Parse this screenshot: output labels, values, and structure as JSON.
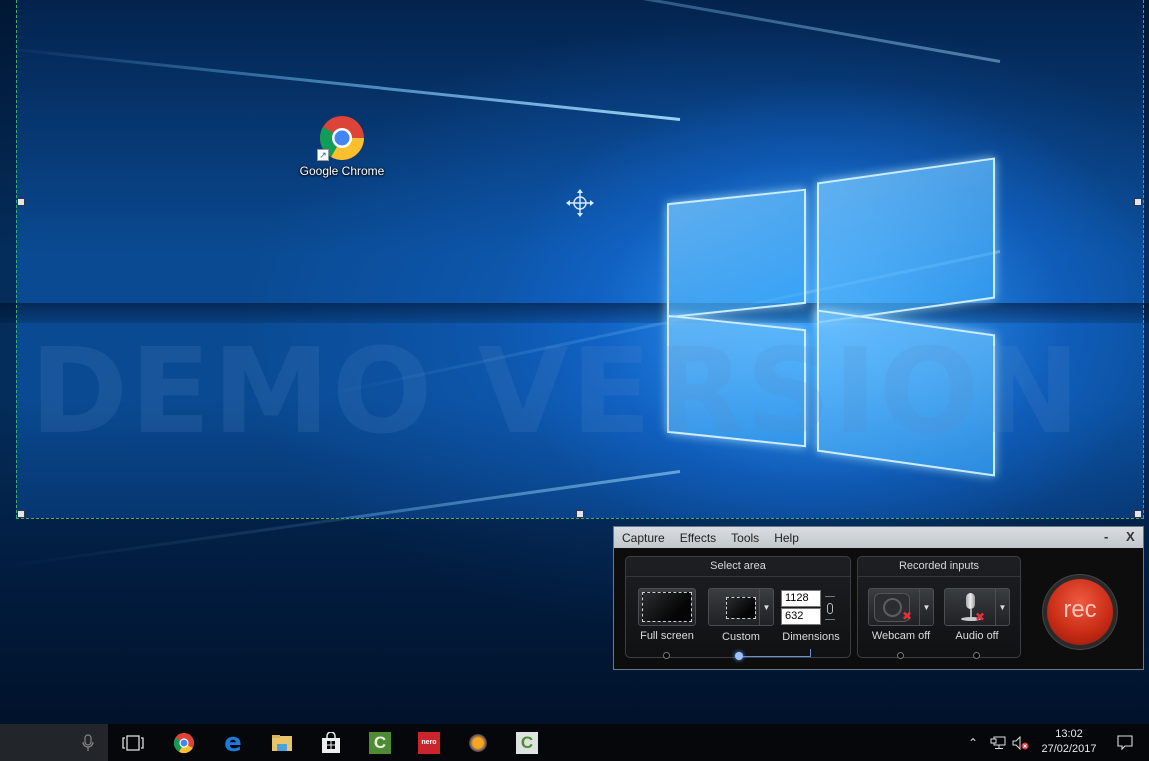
{
  "desktop": {
    "watermark": "DEMO VERSION",
    "shortcuts": [
      {
        "label": "Google Chrome",
        "icon": "chrome-icon"
      }
    ],
    "capture_overlay": {
      "selection_color": "#3fae6a",
      "center_icon": "move-crosshair-icon"
    }
  },
  "recorder": {
    "menu": [
      "Capture",
      "Effects",
      "Tools",
      "Help"
    ],
    "window_buttons": {
      "minimize": "-",
      "close": "X"
    },
    "select_area": {
      "title": "Select area",
      "full_screen_label": "Full screen",
      "custom_label": "Custom",
      "dimensions_label": "Dimensions",
      "width": "1128",
      "height": "632",
      "selected": "Custom"
    },
    "recorded_inputs": {
      "title": "Recorded inputs",
      "webcam_label": "Webcam off",
      "audio_label": "Audio off"
    },
    "rec_label": "rec",
    "rec_color": "#d9351c"
  },
  "taskbar": {
    "pinned": [
      {
        "name": "task-view",
        "icon": "task-view-icon"
      },
      {
        "name": "chrome",
        "icon": "chrome-icon"
      },
      {
        "name": "edge",
        "icon": "edge-icon"
      },
      {
        "name": "file-explorer",
        "icon": "folder-icon"
      },
      {
        "name": "store",
        "icon": "store-icon"
      },
      {
        "name": "camtasia-green",
        "icon": "camtasia-icon"
      },
      {
        "name": "nero",
        "icon": "nero-icon",
        "label": "nero"
      },
      {
        "name": "app-orange",
        "icon": "app-icon"
      },
      {
        "name": "camtasia-recorder",
        "icon": "camtasia-recorder-icon"
      }
    ],
    "tray": {
      "time": "13:02",
      "date": "27/02/2017"
    }
  }
}
